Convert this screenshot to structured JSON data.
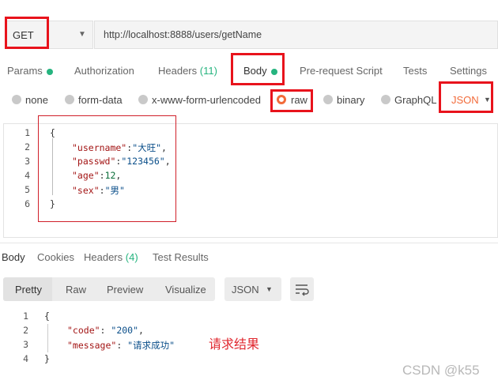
{
  "request": {
    "method": "GET",
    "url": "http://localhost:8888/users/getName"
  },
  "request_tabs": [
    {
      "label": "Params",
      "dot": true
    },
    {
      "label": "Authorization"
    },
    {
      "label": "Headers",
      "count": "(11)"
    },
    {
      "label": "Body",
      "dot": true,
      "active": true
    },
    {
      "label": "Pre-request Script"
    },
    {
      "label": "Tests"
    },
    {
      "label": "Settings"
    }
  ],
  "body_types": [
    {
      "label": "none"
    },
    {
      "label": "form-data"
    },
    {
      "label": "x-www-form-urlencoded"
    },
    {
      "label": "raw",
      "selected": true
    },
    {
      "label": "binary"
    },
    {
      "label": "GraphQL"
    }
  ],
  "body_format": "JSON",
  "request_body": {
    "line_numbers": [
      "1",
      "2",
      "3",
      "4",
      "5",
      "6"
    ],
    "open_brace": "{",
    "close_brace": "}",
    "fields": [
      {
        "key": "\"username\"",
        "value": "\"大旺\"",
        "trail": ","
      },
      {
        "key": "\"passwd\"",
        "value": "\"123456\"",
        "trail": ","
      },
      {
        "key": "\"age\"",
        "value": "12",
        "trail": ","
      },
      {
        "key": "\"sex\"",
        "value": "\"男\"",
        "trail": ""
      }
    ]
  },
  "response_tabs": [
    {
      "label": "Body",
      "active": true
    },
    {
      "label": "Cookies"
    },
    {
      "label": "Headers",
      "count": "(4)"
    },
    {
      "label": "Test Results"
    }
  ],
  "response_view": {
    "modes": [
      "Pretty",
      "Raw",
      "Preview",
      "Visualize"
    ],
    "format": "JSON"
  },
  "response_body": {
    "line_numbers": [
      "1",
      "2",
      "3",
      "4"
    ],
    "open_brace": "{",
    "close_brace": "}",
    "fields": [
      {
        "key": "\"code\"",
        "value": "\"200\"",
        "trail": ","
      },
      {
        "key": "\"message\"",
        "value": "\"请求成功\"",
        "trail": ""
      }
    ]
  },
  "annotation": "请求结果",
  "watermark": "CSDN @k55",
  "colors": {
    "accent": "#f26b3a",
    "success_dot": "#26b47f",
    "highlight_box": "#e8131c"
  },
  "icons": {
    "method_caret": "chevron-down-icon",
    "format_caret": "chevron-down-icon",
    "wrap": "wrap-lines-icon"
  }
}
